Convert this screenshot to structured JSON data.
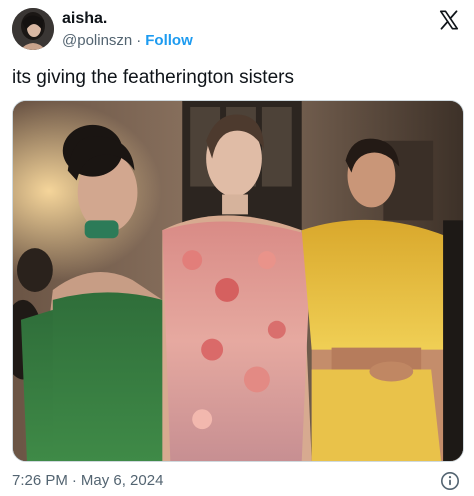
{
  "author": {
    "display_name": "aisha.",
    "handle": "@polinszn",
    "separator": "·",
    "follow_label": "Follow"
  },
  "tweet": {
    "text": "its giving the featherington sisters"
  },
  "meta": {
    "time": "7:26 PM",
    "separator": "·",
    "date": "May 6, 2024"
  },
  "icons": {
    "brand": "x-logo-icon",
    "info": "info-icon"
  },
  "colors": {
    "accent": "#1d9bf0",
    "secondary_text": "#536471",
    "primary_text": "#0f1419",
    "border": "#cfd9de"
  }
}
